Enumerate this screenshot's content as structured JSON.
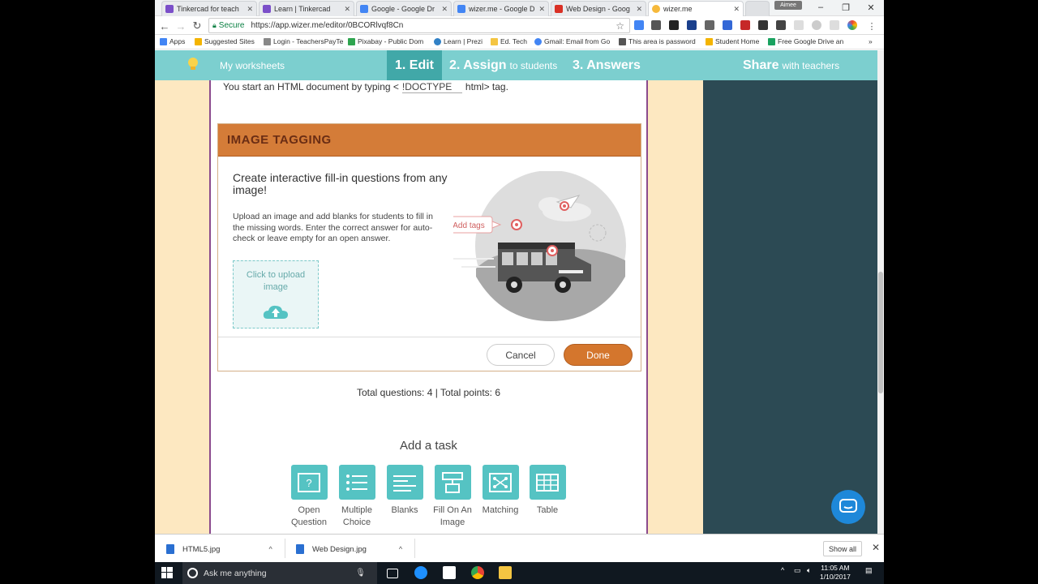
{
  "browser": {
    "tabs": [
      {
        "label": "Tinkercad for teach",
        "color": "#7b4fc9"
      },
      {
        "label": "Learn | Tinkercad",
        "color": "#7b4fc9"
      },
      {
        "label": "Google - Google Dr",
        "color": "#4285f4"
      },
      {
        "label": "wizer.me - Google D",
        "color": "#4285f4"
      },
      {
        "label": "Web Design - Goog",
        "color": "#d93025"
      },
      {
        "label": "wizer.me",
        "color": "#f6b93b"
      }
    ],
    "user_chip": "Aimee",
    "address": {
      "secure_label": "Secure",
      "url": "https://app.wizer.me/editor/0BCORlvqf8Cn"
    },
    "bookmarks": [
      {
        "label": "Apps",
        "color": "#4285f4"
      },
      {
        "label": "Suggested Sites",
        "color": "#f4b400"
      },
      {
        "label": "Login - TeachersPayTe",
        "color": "#888888"
      },
      {
        "label": "Pixabay - Public Dom",
        "color": "#2ea44f"
      },
      {
        "label": "Learn | Prezi",
        "color": "#3181c6"
      },
      {
        "label": "Ed. Tech",
        "color": "#f4c542"
      },
      {
        "label": "Gmail: Email from Go",
        "color": "#4285f4"
      },
      {
        "label": "This area is password",
        "color": "#555555"
      },
      {
        "label": "Student Home",
        "color": "#f4b400"
      },
      {
        "label": "Free Google Drive an",
        "color": "#1aa260"
      }
    ]
  },
  "app": {
    "nav": {
      "my_worksheets": "My worksheets",
      "edit": "1. Edit",
      "assign": "2. Assign",
      "assign_sub": "to students",
      "answers": "3. Answers",
      "share": "Share",
      "share_sub": "with teachers"
    },
    "previous_question": {
      "before": "You start an HTML document by typing <",
      "blank": "!DOCTYPE",
      "after": "html> tag."
    },
    "image_tagging": {
      "header": "IMAGE TAGGING",
      "title": "Create interactive fill-in questions from any image!",
      "description": "Upload an image and add blanks for students to fill in the missing words. Enter the correct answer for auto-check or leave empty for an open answer.",
      "upload_label": "Click to upload image",
      "illustration_tag": "Add tags",
      "cancel": "Cancel",
      "done": "Done"
    },
    "totals": "Total questions: 4 | Total points: 6",
    "add_task": {
      "title": "Add a task",
      "items": [
        {
          "label": "Open Question",
          "icon": "open-question-icon"
        },
        {
          "label": "Multiple Choice",
          "icon": "multiple-choice-icon"
        },
        {
          "label": "Blanks",
          "icon": "blanks-icon"
        },
        {
          "label": "Fill On An Image",
          "icon": "fill-on-image-icon"
        },
        {
          "label": "Matching",
          "icon": "matching-icon"
        },
        {
          "label": "Table",
          "icon": "table-icon"
        }
      ]
    },
    "colors": {
      "nav": "#7ccfcf",
      "nav_active": "#41a8a8",
      "header_orange": "#d47c38",
      "done_orange": "#d4762d",
      "task_teal": "#55c3c3",
      "dark_panel": "#2c4a54",
      "page_bg": "#fde8c1"
    }
  },
  "downloads": {
    "items": [
      {
        "name": "HTML5.jpg"
      },
      {
        "name": "Web Design.jpg"
      }
    ],
    "show_all": "Show all"
  },
  "taskbar": {
    "search_placeholder": "Ask me anything",
    "time": "11:05 AM",
    "date": "1/10/2017"
  }
}
